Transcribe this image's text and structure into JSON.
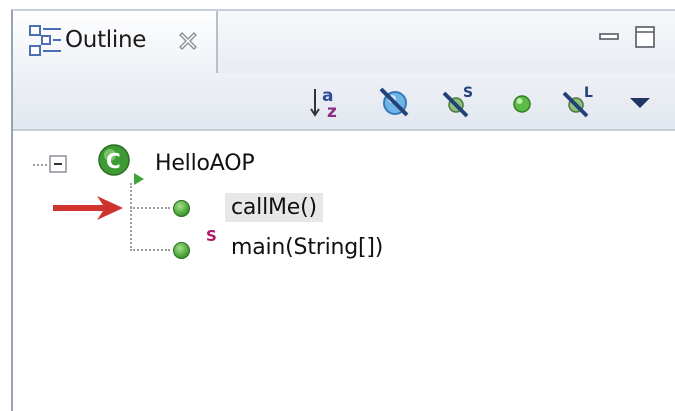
{
  "view": {
    "tab_label": "Outline",
    "tab_icon": "outline-icon",
    "close_icon": "close-icon",
    "minimize_icon": "minimize-icon",
    "maximize_icon": "maximize-icon"
  },
  "toolbar": {
    "buttons": [
      {
        "name": "sort-alphabetically-icon"
      },
      {
        "name": "hide-fields-icon"
      },
      {
        "name": "hide-static-members-icon"
      },
      {
        "name": "hide-non-public-members-icon"
      },
      {
        "name": "hide-local-types-icon"
      },
      {
        "name": "view-menu-icon"
      }
    ]
  },
  "tree": {
    "root": {
      "label": "HelloAOP",
      "icon": "class-icon",
      "expanded": true,
      "toggle_icon": "collapse-icon"
    },
    "children": [
      {
        "label": "callMe()",
        "icon": "public-method-icon",
        "static": false,
        "selected": true
      },
      {
        "label": "main(String[])",
        "icon": "public-method-icon",
        "static": true,
        "static_mark": "S",
        "selected": false
      }
    ]
  },
  "annotation": {
    "arrow_icon": "red-arrow-icon",
    "arrow_color": "#d0322c"
  },
  "colors": {
    "method_green": "#3c9a2b",
    "class_green": "#2f8f24",
    "static_mark": "#b0156a",
    "tab_border": "#b7bfcd",
    "selection": "#e7e7e7"
  }
}
